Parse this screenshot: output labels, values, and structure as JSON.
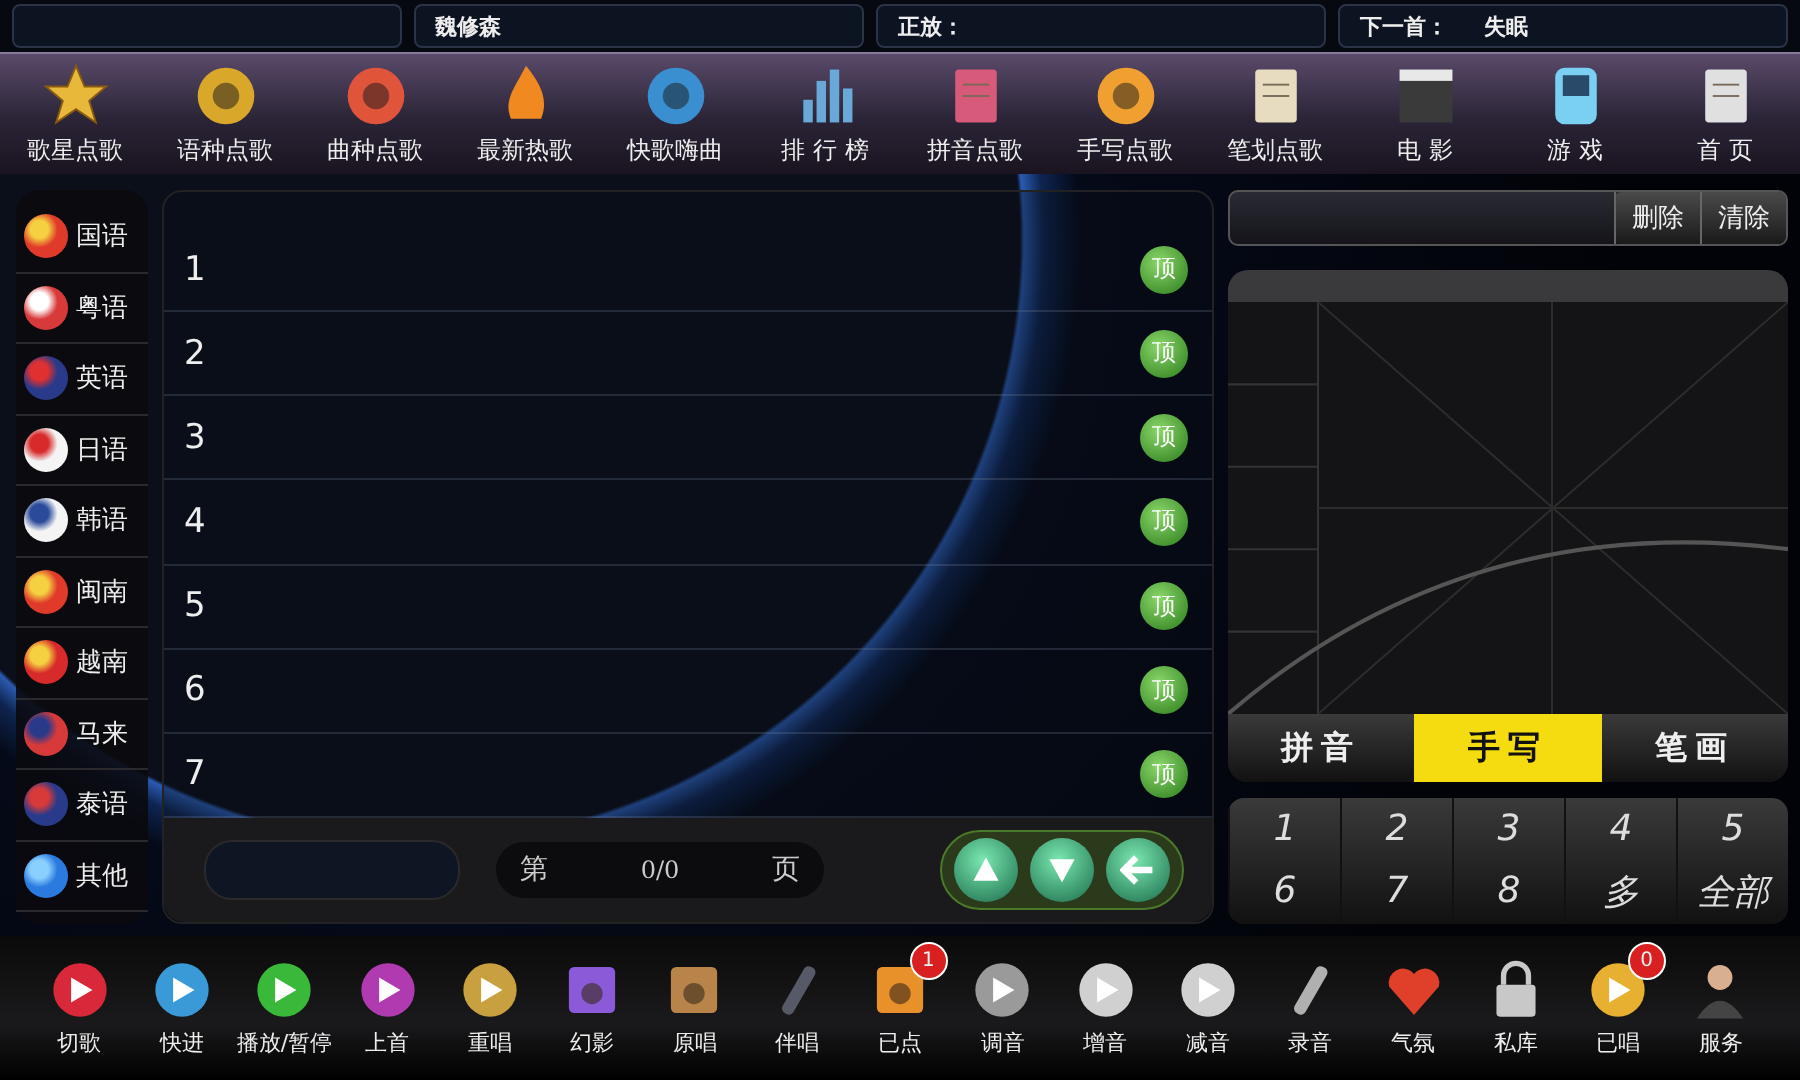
{
  "now_playing_bar": {
    "singer": "魏修森",
    "playing_label": "正放：",
    "next_label": "下一首：",
    "next_song": "失眠"
  },
  "nav": [
    {
      "label": "歌星点歌"
    },
    {
      "label": "语种点歌"
    },
    {
      "label": "曲种点歌"
    },
    {
      "label": "最新热歌"
    },
    {
      "label": "快歌嗨曲"
    },
    {
      "label": "排 行 榜"
    },
    {
      "label": "拼音点歌"
    },
    {
      "label": "手写点歌"
    },
    {
      "label": "笔划点歌"
    },
    {
      "label": "电 影"
    },
    {
      "label": "游 戏"
    },
    {
      "label": "首 页"
    }
  ],
  "languages": [
    {
      "label": "国语"
    },
    {
      "label": "粤语"
    },
    {
      "label": "英语"
    },
    {
      "label": "日语"
    },
    {
      "label": "韩语"
    },
    {
      "label": "闽南"
    },
    {
      "label": "越南"
    },
    {
      "label": "马来"
    },
    {
      "label": "泰语"
    },
    {
      "label": "其他"
    }
  ],
  "songs": [
    {
      "number": "1",
      "top_button": "顶"
    },
    {
      "number": "2",
      "top_button": "顶"
    },
    {
      "number": "3",
      "top_button": "顶"
    },
    {
      "number": "4",
      "top_button": "顶"
    },
    {
      "number": "5",
      "top_button": "顶"
    },
    {
      "number": "6",
      "top_button": "顶"
    },
    {
      "number": "7",
      "top_button": "顶"
    }
  ],
  "pager": {
    "prefix": "第",
    "page": "0/0",
    "suffix": "页"
  },
  "search": {
    "delete_button": "删除",
    "clear_button": "清除"
  },
  "input_modes": [
    {
      "label": "拼音",
      "selected": false
    },
    {
      "label": "手写",
      "selected": true
    },
    {
      "label": "笔画",
      "selected": false
    }
  ],
  "candidates": [
    "1",
    "2",
    "3",
    "4",
    "5",
    "6",
    "7",
    "8",
    "多",
    "全部"
  ],
  "toolbar": [
    {
      "label": "切歌"
    },
    {
      "label": "快进"
    },
    {
      "label": "播放/暂停"
    },
    {
      "label": "上首"
    },
    {
      "label": "重唱"
    },
    {
      "label": "幻影"
    },
    {
      "label": "原唱"
    },
    {
      "label": "伴唱"
    },
    {
      "label": "已点",
      "badge": "1"
    },
    {
      "label": "调音"
    },
    {
      "label": "增音"
    },
    {
      "label": "减音"
    },
    {
      "label": "录音"
    },
    {
      "label": "气氛"
    },
    {
      "label": "私库"
    },
    {
      "label": "已唱",
      "badge": "0"
    },
    {
      "label": "服务"
    }
  ]
}
